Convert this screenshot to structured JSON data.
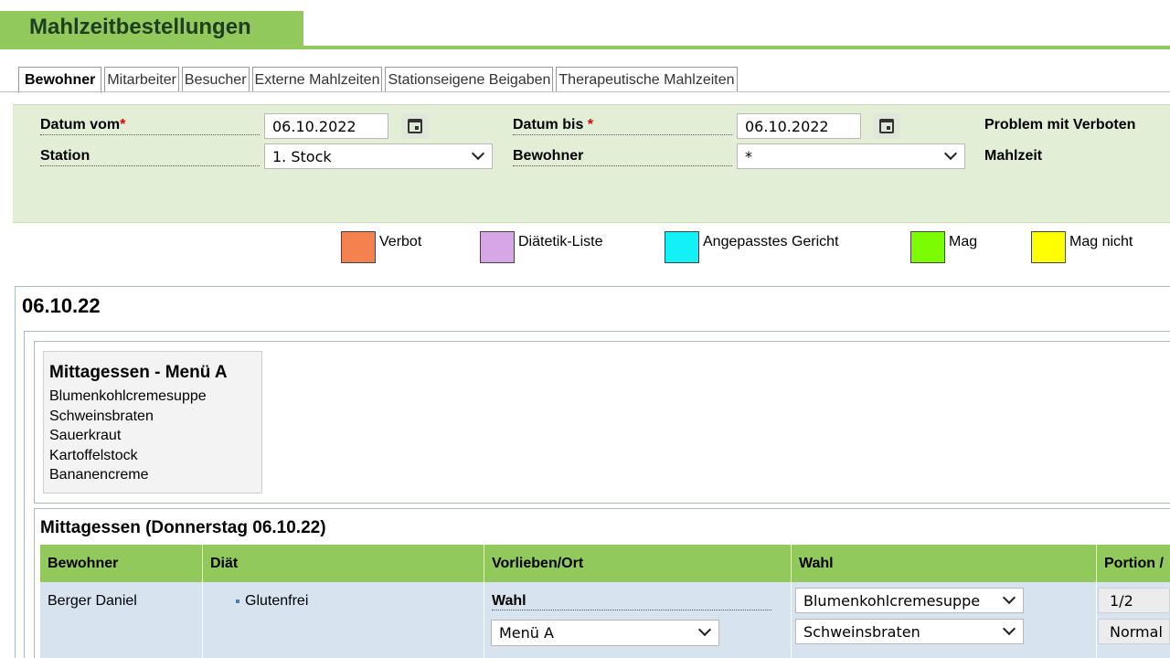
{
  "page": {
    "title": "Mahlzeitbestellungen"
  },
  "tabs": [
    {
      "label": "Bewohner",
      "active": true
    },
    {
      "label": "Mitarbeiter",
      "active": false
    },
    {
      "label": "Besucher",
      "active": false
    },
    {
      "label": "Externe Mahlzeiten",
      "active": false
    },
    {
      "label": "Stationseigene Beigaben",
      "active": false
    },
    {
      "label": "Therapeutische Mahlzeiten",
      "active": false
    }
  ],
  "filters": {
    "date_from": {
      "label": "Datum vom",
      "required_mark": "*",
      "value": "06.10.2022"
    },
    "date_to": {
      "label": "Datum bis ",
      "required_mark": "*",
      "value": "06.10.2022"
    },
    "problem": {
      "label": "Problem mit Verboten"
    },
    "station": {
      "label": "Station",
      "value": "1. Stock"
    },
    "resident": {
      "label": "Bewohner",
      "value": "*"
    },
    "meal": {
      "label": "Mahlzeit"
    }
  },
  "legend": [
    {
      "label": "Verbot",
      "color": "#f5814f"
    },
    {
      "label": "Diätetik-Liste",
      "color": "#d6a6e6"
    },
    {
      "label": "Angepasstes Gericht",
      "color": "#12f2f6"
    },
    {
      "label": "Mag",
      "color": "#7cfc00"
    },
    {
      "label": "Mag nicht",
      "color": "#ffff00"
    }
  ],
  "content": {
    "date_heading": "06.10.22",
    "menu_card": {
      "title": "Mittagessen - Menü A",
      "items": [
        "Blumenkohlcremesuppe",
        "Schweinsbraten",
        "Sauerkraut",
        "Kartoffelstock",
        "Bananencreme"
      ]
    },
    "section_title": "Mittagessen (Donnerstag 06.10.22)",
    "table": {
      "headers": [
        "Bewohner",
        "Diät",
        "Vorlieben/Ort",
        "Wahl",
        "Portion /"
      ],
      "rows": [
        {
          "resident": "Berger Daniel",
          "diet": "Glutenfrei",
          "pref_label": "Wahl",
          "pref_value": "Menü A",
          "choice_1": "Blumenkohlcremesuppe",
          "choice_2": "Schweinsbraten",
          "portion_1": "1/2",
          "portion_2": "Normal"
        }
      ]
    }
  }
}
